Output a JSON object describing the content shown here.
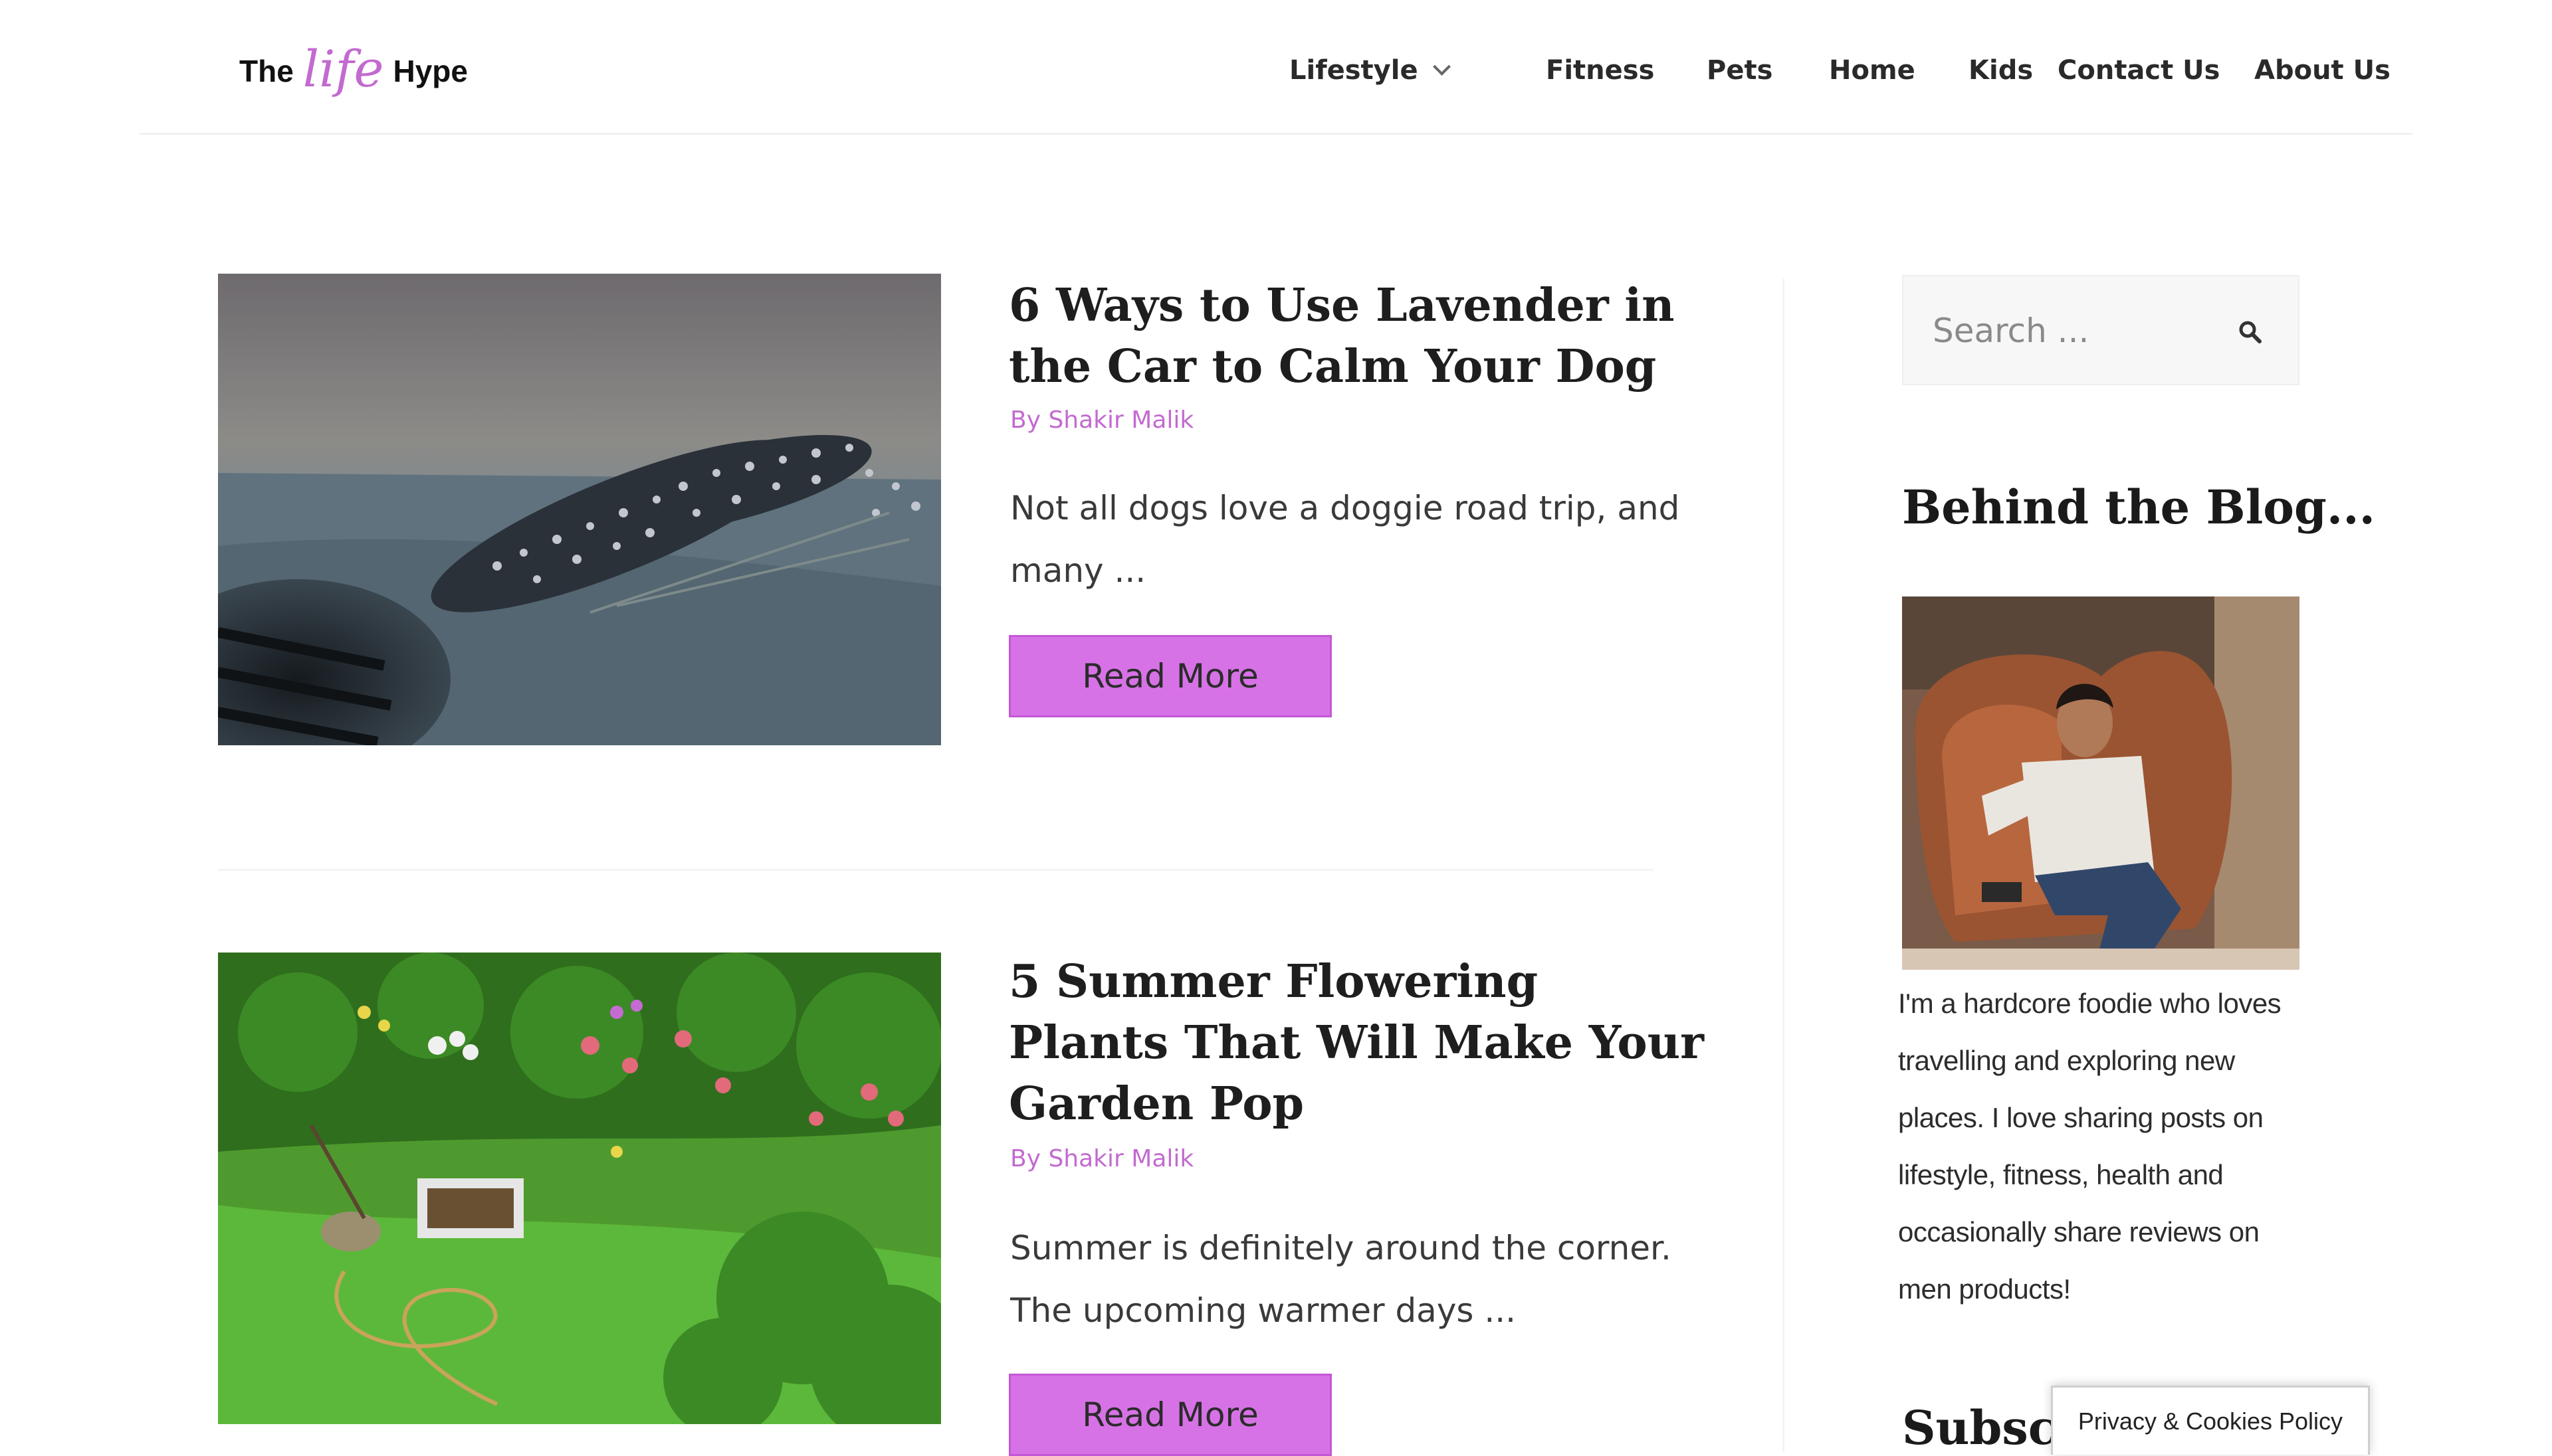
{
  "site": {
    "logo": {
      "word1": "The",
      "script": "life",
      "word2": "Hype"
    },
    "accent_color": "#d772e6",
    "link_color": "#c36ad0"
  },
  "nav": {
    "items": [
      {
        "label": "Lifestyle",
        "has_dropdown": true
      },
      {
        "label": "Fitness"
      },
      {
        "label": "Pets"
      },
      {
        "label": "Home"
      },
      {
        "label": "Kids"
      },
      {
        "label": "Contact Us"
      },
      {
        "label": "About Us"
      }
    ]
  },
  "posts": [
    {
      "title": "6 Ways to Use Lavender in the Car to Calm Your Dog",
      "author": "By Shakir Malik",
      "excerpt": "Not all dogs love a doggie road trip, and many ...",
      "read_more": "Read More",
      "image_subject": "dried lavender bundle on a car dashboard"
    },
    {
      "title": "5 Summer Flowering Plants That Will Make Your Garden Pop",
      "author": "By Shakir Malik",
      "excerpt": "Summer is definitely around the corner. The upcoming warmer days ...",
      "read_more": "Read More",
      "image_subject": "garden flower beds with lawn and hose"
    }
  ],
  "sidebar": {
    "search_placeholder": "Search ...",
    "search_icon": "search-icon",
    "behind_title": "Behind the Blog...",
    "about_image_subject": "man sitting in a brown leather chair",
    "about_text": "I'm a hardcore foodie who loves travelling and exploring new places. I love sharing posts on lifestyle, fitness, health and occasionally share reviews on men products!",
    "subscribe_title": "Subscribe"
  },
  "privacy_button": "Privacy & Cookies Policy"
}
